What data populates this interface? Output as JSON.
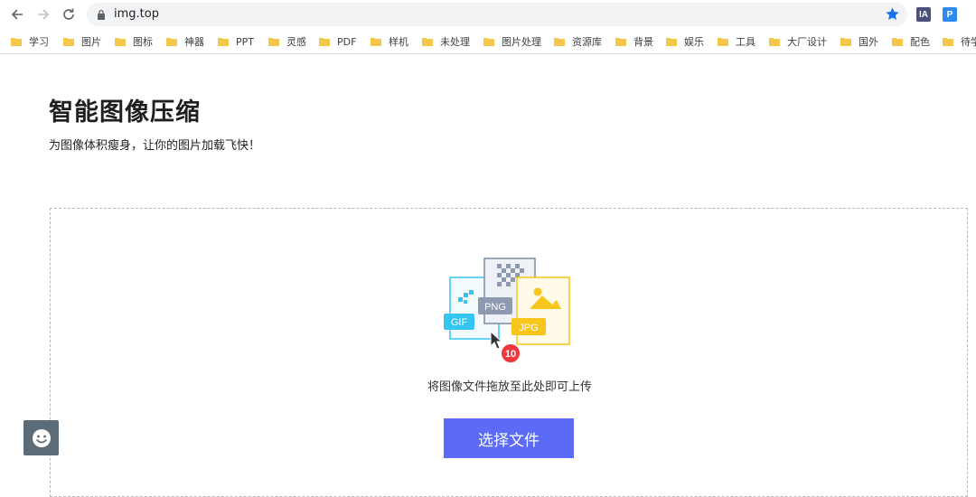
{
  "browser": {
    "url": "img.top",
    "icons": {
      "back": "arrow-left-icon",
      "forward": "arrow-right-icon",
      "reload": "reload-icon",
      "secure": "lock-icon",
      "bookmark": "star-icon"
    },
    "extensions": [
      {
        "label": "IA",
        "color": "#4a4f7c"
      },
      {
        "label": "P",
        "color": "#2d8ceb"
      }
    ]
  },
  "bookmarks": [
    {
      "label": "学习"
    },
    {
      "label": "图片"
    },
    {
      "label": "图标"
    },
    {
      "label": "神器"
    },
    {
      "label": "PPT"
    },
    {
      "label": "灵感"
    },
    {
      "label": "PDF"
    },
    {
      "label": "样机"
    },
    {
      "label": "未处理"
    },
    {
      "label": "图片处理"
    },
    {
      "label": "资源库"
    },
    {
      "label": "背景"
    },
    {
      "label": "娱乐"
    },
    {
      "label": "工具"
    },
    {
      "label": "大厂设计"
    },
    {
      "label": "国外"
    },
    {
      "label": "配色"
    },
    {
      "label": "待学"
    }
  ],
  "page": {
    "title": "智能图像压缩",
    "subtitle": "为图像体积瘦身，让你的图片加载飞快！"
  },
  "uploader": {
    "formats": [
      "GIF",
      "PNG",
      "JPG"
    ],
    "file_count_badge": "10",
    "hint": "将图像文件拖放至此处即可上传",
    "button_label": "选择文件",
    "accent_color": "#5b6bf5"
  },
  "feedback": {
    "icon": "smiley-icon"
  }
}
